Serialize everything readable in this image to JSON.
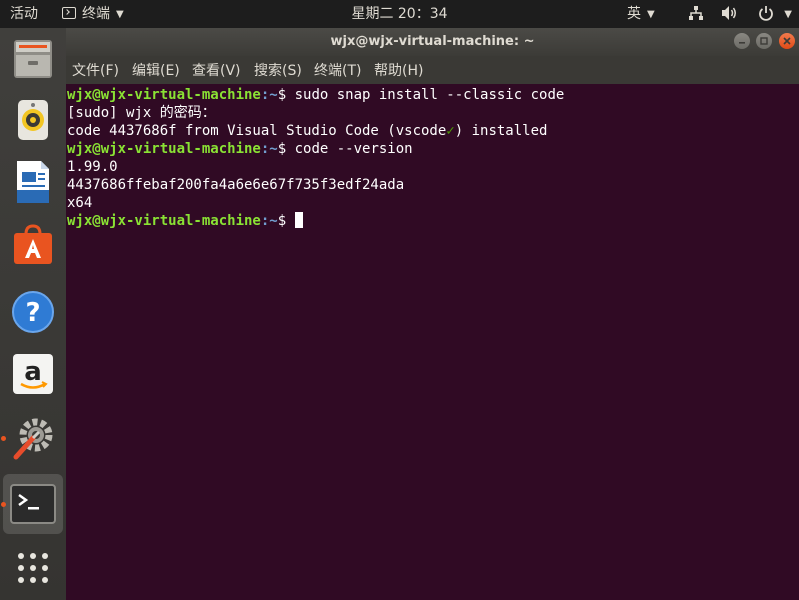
{
  "topbar": {
    "activities": "活动",
    "app_name": "终端",
    "clock": "星期二 20：34",
    "input_method": "英"
  },
  "window": {
    "title": "wjx@wjx-virtual-machine: ~"
  },
  "menu": {
    "file": "文件(F)",
    "edit": "编辑(E)",
    "view": "查看(V)",
    "search": "搜索(S)",
    "terminal": "终端(T)",
    "help": "帮助(H)"
  },
  "prompt": {
    "user_host": "wjx@wjx-virtual-machine",
    "path": ":~",
    "symbol": "$ "
  },
  "terminal": {
    "cmd1": "sudo snap install --classic code",
    "sudo_prompt": "[sudo] wjx 的密码：",
    "install_before": "code 4437686f from Visual Studio Code (vscode",
    "install_check": "✓",
    "install_after": ") installed",
    "cmd2": "code --version",
    "version": "1.99.0",
    "commit": "4437686ffebaf200fa4a6e6e67f735f3edf24ada",
    "arch": "x64"
  },
  "dock": {
    "items": [
      "files-icon",
      "rhythmbox-icon",
      "writer-icon",
      "software-icon",
      "help-icon",
      "amazon-icon",
      "settings-icon",
      "terminal-icon",
      "app-grid-icon"
    ]
  },
  "colors": {
    "terminal_bg": "#300a24",
    "prompt_user": "#8ae234",
    "prompt_path": "#729fcf",
    "ubuntu_orange": "#e95420"
  }
}
